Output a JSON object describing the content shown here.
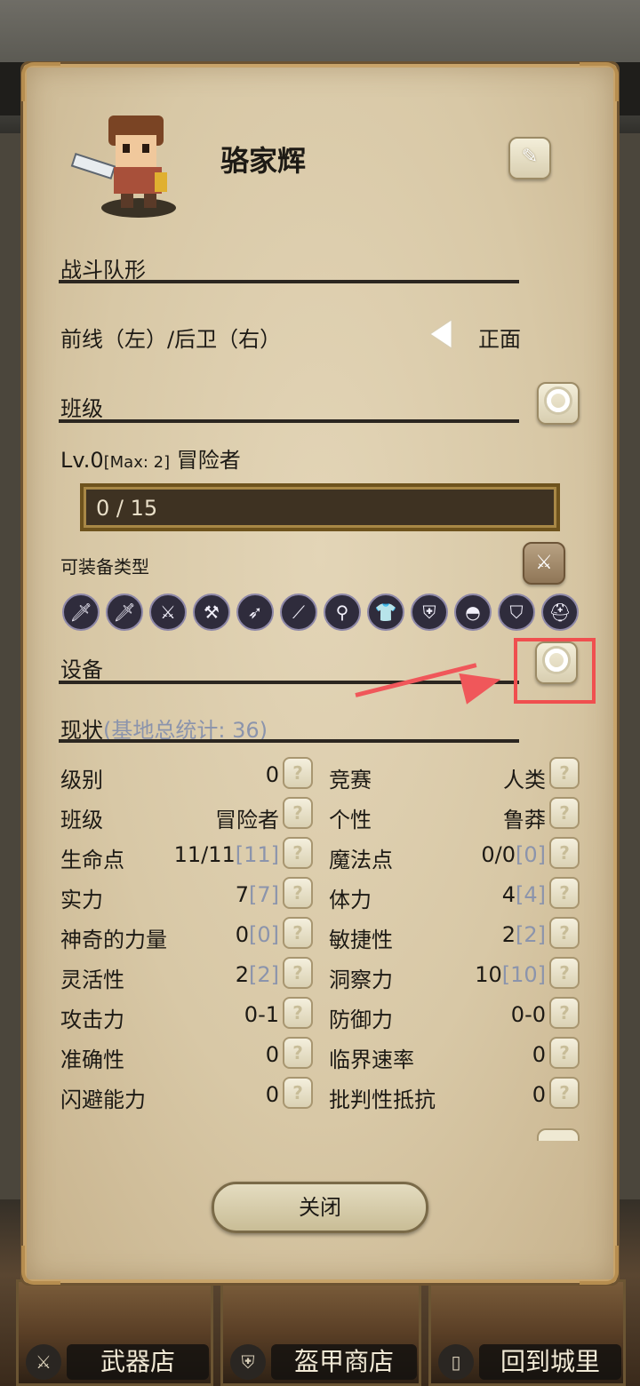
{
  "character": {
    "name": "骆家辉"
  },
  "formation": {
    "title": "战斗队形",
    "row_label": "前线（左）/后卫（右）",
    "direction_value": "正面"
  },
  "class_section": {
    "title": "班级",
    "level_prefix": "Lv.0",
    "level_max": "[Max: 2]",
    "class_name": "冒险者",
    "xp_text": "0 / 15",
    "xp_progress": 0.0,
    "equip_types_title": "可装备类型",
    "equip_types": [
      "dagger-icon",
      "sword-icon",
      "longsword-icon",
      "axe-icon",
      "bow-icon",
      "spear-icon",
      "staff-icon",
      "cloth-armor-icon",
      "light-armor-icon",
      "helmet-orb-icon",
      "shield-icon",
      "heavy-helmet-icon"
    ]
  },
  "equipment": {
    "title": "设备"
  },
  "status": {
    "title": "现状",
    "subtitle": "(基地总统计: 36)",
    "rows": [
      {
        "left_label": "级别",
        "left_value": "0",
        "left_base": "",
        "right_label": "竞赛",
        "right_value": "人类",
        "right_base": ""
      },
      {
        "left_label": "班级",
        "left_value": "冒险者",
        "left_base": "",
        "right_label": "个性",
        "right_value": "鲁莽",
        "right_base": ""
      },
      {
        "left_label": "生命点",
        "left_value": "11/11",
        "left_base": "[11]",
        "right_label": "魔法点",
        "right_value": "0/0",
        "right_base": "[0]"
      },
      {
        "left_label": "实力",
        "left_value": "7",
        "left_base": "[7]",
        "right_label": "体力",
        "right_value": "4",
        "right_base": "[4]"
      },
      {
        "left_label": "神奇的力量",
        "left_value": "0",
        "left_base": "[0]",
        "right_label": "敏捷性",
        "right_value": "2",
        "right_base": "[2]"
      },
      {
        "left_label": "灵活性",
        "left_value": "2",
        "left_base": "[2]",
        "right_label": "洞察力",
        "right_value": "10",
        "right_base": "[10]"
      },
      {
        "left_label": "攻击力",
        "left_value": "0-1",
        "left_base": "",
        "right_label": "防御力",
        "right_value": "0-0",
        "right_base": ""
      },
      {
        "left_label": "准确性",
        "left_value": "0",
        "left_base": "",
        "right_label": "临界速率",
        "right_value": "0",
        "right_base": ""
      },
      {
        "left_label": "闪避能力",
        "left_value": "0",
        "left_base": "",
        "right_label": "批判性抵抗",
        "right_value": "0",
        "right_base": ""
      }
    ],
    "help_glyph": "?"
  },
  "buttons": {
    "close": "关闭"
  },
  "shop_bar": {
    "items": [
      {
        "label": "武器店",
        "icon": "crossed-swords-icon"
      },
      {
        "label": "盔甲商店",
        "icon": "armor-icon"
      },
      {
        "label": "回到城里",
        "icon": "door-icon"
      }
    ]
  },
  "colors": {
    "highlight": "#f04f4f",
    "panel": "#d8c8a6",
    "bar_border": "#6e531d"
  }
}
